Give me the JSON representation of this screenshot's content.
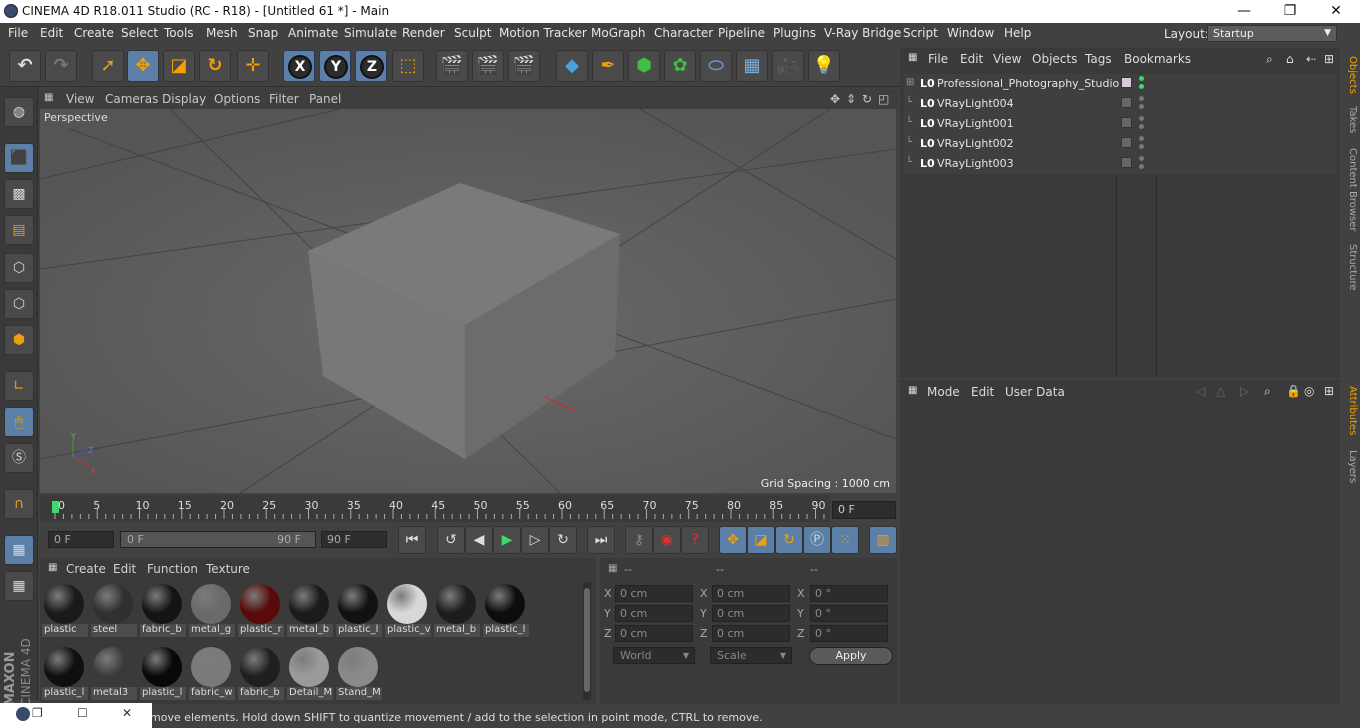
{
  "window": {
    "title": "CINEMA 4D R18.011 Studio (RC - R18) - [Untitled 61 *] - Main",
    "minimize": "—",
    "maximize": "❐",
    "close": "✕"
  },
  "menu": [
    "File",
    "Edit",
    "Create",
    "Select",
    "Tools",
    "Mesh",
    "Snap",
    "Animate",
    "Simulate",
    "Render",
    "Sculpt",
    "Motion Tracker",
    "MoGraph",
    "Character",
    "Pipeline",
    "Plugins",
    "V-Ray Bridge",
    "Script",
    "Window",
    "Help"
  ],
  "layout": {
    "label": "Layout:",
    "value": "Startup"
  },
  "viewport": {
    "menu": [
      "View",
      "Cameras",
      "Display",
      "Options",
      "Filter",
      "Panel"
    ],
    "label": "Perspective",
    "grid_spacing": "Grid Spacing : 1000 cm"
  },
  "timeline": {
    "ticks": [
      "0",
      "5",
      "10",
      "15",
      "20",
      "25",
      "30",
      "35",
      "40",
      "45",
      "50",
      "55",
      "60",
      "65",
      "70",
      "75",
      "80",
      "85",
      "90"
    ],
    "current_frame": "0 F"
  },
  "playback": {
    "start_field": "0 F",
    "range_left": "0 F",
    "range_right": "90 F",
    "end_field": "90 F"
  },
  "materials": {
    "menu": [
      "Create",
      "Edit",
      "Function",
      "Texture"
    ],
    "items": [
      {
        "name": "plastic",
        "color": "#1a1a1a"
      },
      {
        "name": "steel",
        "color": "#303030"
      },
      {
        "name": "fabric_b",
        "color": "#141414"
      },
      {
        "name": "metal_g",
        "color": "#6a6a6a"
      },
      {
        "name": "plastic_r",
        "color": "#5a0a0a"
      },
      {
        "name": "metal_b",
        "color": "#1b1b1b"
      },
      {
        "name": "plastic_l",
        "color": "#111"
      },
      {
        "name": "plastic_v",
        "color": "#d8d8d8"
      },
      {
        "name": "metal_b",
        "color": "#1d1d1d"
      },
      {
        "name": "plastic_l",
        "color": "#0d0d0d"
      },
      {
        "name": "plastic_l",
        "color": "#0f0f0f"
      },
      {
        "name": "metal3",
        "color": "#3a3a3a"
      },
      {
        "name": "plastic_l",
        "color": "#080808"
      },
      {
        "name": "fabric_w",
        "color": "#7a7a7a"
      },
      {
        "name": "fabric_b",
        "color": "#1f1f1f"
      },
      {
        "name": "Detail_M",
        "color": "#9a9a9a"
      },
      {
        "name": "Stand_M",
        "color": "#8a8a8a"
      }
    ]
  },
  "coords": {
    "headers": [
      "--",
      "--",
      "--"
    ],
    "pos": [
      "0 cm",
      "0 cm",
      "0 cm"
    ],
    "size": [
      "0 cm",
      "0 cm",
      "0 cm"
    ],
    "rot": [
      "0 °",
      "0 °",
      "0 °"
    ],
    "axes": [
      "X",
      "Y",
      "Z"
    ],
    "world": "World",
    "scale": "Scale",
    "apply": "Apply"
  },
  "objects": {
    "menu": [
      "File",
      "Edit",
      "View",
      "Objects",
      "Tags",
      "Bookmarks"
    ],
    "items": [
      "Professional_Photography_Studio",
      "VRayLight004",
      "VRayLight001",
      "VRayLight002",
      "VRayLight003"
    ]
  },
  "attributes": {
    "menu": [
      "Mode",
      "Edit",
      "User Data"
    ]
  },
  "sidetabs": [
    "Objects",
    "Takes",
    "Content Browser",
    "Structure",
    "Attributes",
    "Layers"
  ],
  "status": "move elements. Hold down SHIFT to quantize movement / add to the selection in point mode, CTRL to remove.",
  "brand": {
    "line1": "MAXON",
    "line2": "CINEMA 4D"
  }
}
